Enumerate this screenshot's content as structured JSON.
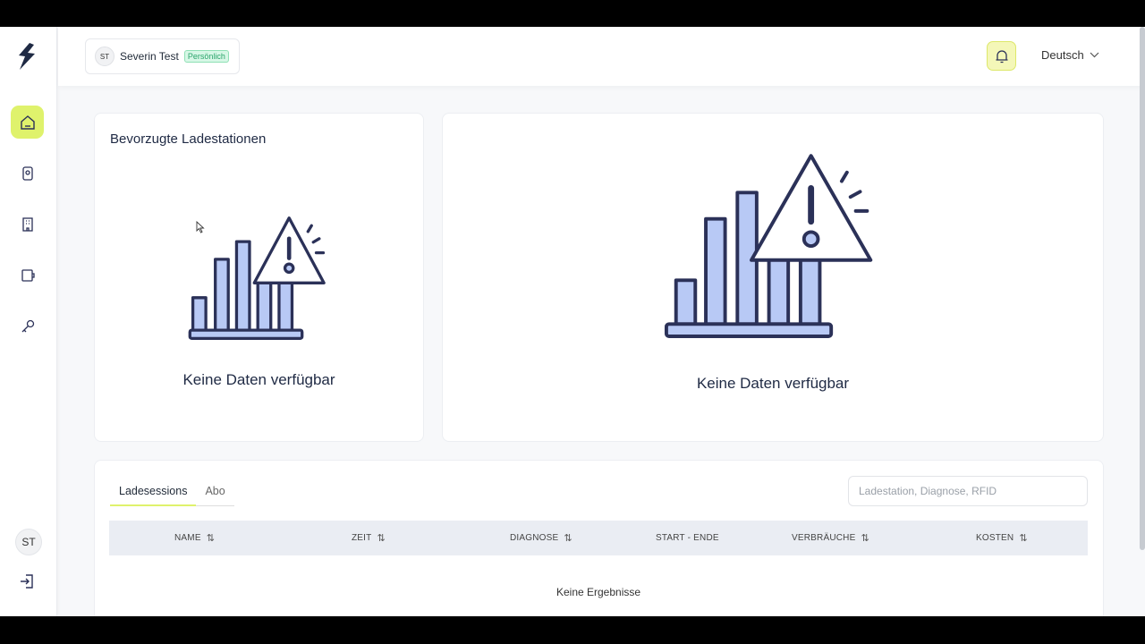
{
  "header": {
    "user_initials": "ST",
    "user_name": "Severin Test",
    "user_badge": "Persönlich",
    "language": "Deutsch"
  },
  "sidebar": {
    "items": [
      {
        "icon": "home-icon"
      },
      {
        "icon": "charger-icon"
      },
      {
        "icon": "building-icon"
      },
      {
        "icon": "wallet-icon"
      },
      {
        "icon": "key-icon"
      }
    ],
    "avatar_initials": "ST"
  },
  "favorites_card": {
    "title": "Bevorzugte Ladestationen",
    "empty_text": "Keine Daten verfügbar"
  },
  "stats_card": {
    "empty_text": "Keine Daten verfügbar"
  },
  "sessions": {
    "tabs": [
      {
        "label": "Ladesessions",
        "active": true
      },
      {
        "label": "Abo",
        "active": false
      }
    ],
    "search_placeholder": "Ladestation, Diagnose, RFID",
    "columns": [
      {
        "label": "NAME",
        "sortable": true
      },
      {
        "label": "ZEIT",
        "sortable": true
      },
      {
        "label": "DIAGNOSE",
        "sortable": true
      },
      {
        "label": "START - ENDE",
        "sortable": false
      },
      {
        "label": "VERBRÄUCHE",
        "sortable": true
      },
      {
        "label": "KOSTEN",
        "sortable": true
      }
    ],
    "sort_glyph": "⇅",
    "empty_text": "Keine Ergebnisse"
  },
  "colors": {
    "accent": "#dff26c",
    "illustration_fill": "#b8c9f5",
    "illustration_stroke": "#2b3158"
  }
}
